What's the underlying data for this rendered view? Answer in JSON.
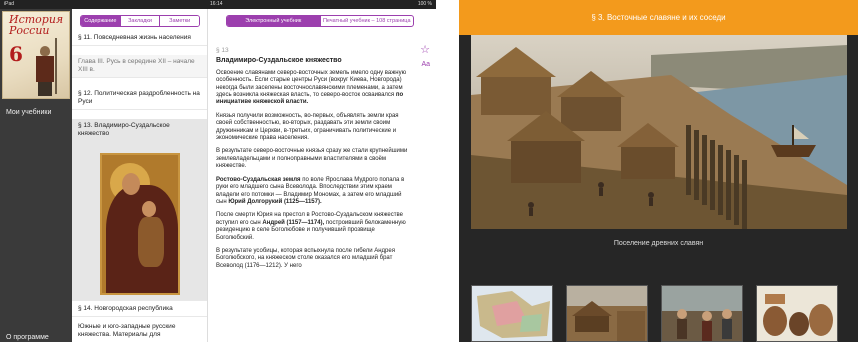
{
  "left_ipad": {
    "status": {
      "device": "iPad",
      "time": "16:14",
      "battery": "100 %"
    },
    "shelf": {
      "cover_title": "История России",
      "cover_grade": "6",
      "my_books": "Мои учебники",
      "about": "О программе"
    },
    "toc": {
      "tabs": [
        "Содержание",
        "Закладки",
        "Заметки"
      ],
      "items": [
        "§ 11. Повседневная жизнь населения",
        "Глава III. Русь в середине XII – начале XIII в.",
        "§ 12. Политическая раздробленность на Руси",
        "§ 13. Владимиро-Суздальское княжество",
        "§ 14. Новгородская республика",
        "Южные и юго-западные русские княжества. Материалы для"
      ]
    },
    "reader": {
      "tabs": [
        "Электронный учебник",
        "Печатный учебник – 108 страница"
      ],
      "section": "§ 13",
      "heading": "Владимиро-Суздальское княжество",
      "paragraphs": [
        "Освоение славянами северо-восточных земель имело одну важную особенность. Если старые центры Руси (вокруг Киева, Новгорода) некогда были заселены восточнославянскими племенами, а затем здесь возникла княжеская власть, то северо-восток осваивался",
        "Князья получили возможность, во-первых, объявлять земли края своей собственностью, во-вторых, раздавать эти земли своим дружинникам и Церкви, в-третьих, ограничивать политические и экономические права населения.",
        "В результате северо-восточные князья сразу же стали крупнейшими землевладельцами и полноправными властителями в своём княжестве.",
        "по воле Ярослава Мудрого попала в руки его младшего сына Всеволода. Впоследствии этим краем владели его потомки — Владимир Мономах, а затем его младший сын",
        "После смерти Юрия на престол в Ростово-Суздальском княжестве вступил его сын",
        "построивший белокаменную резиденцию в селе Боголюбове и получивший прозвище Боголюбский.",
        "В результате усобицы, которая вспыхнула после гибели Андрея Боголюбского, на княжеском столе оказался его"
      ],
      "p1_bold": "по инициативе княжеской власти.",
      "p4_bold": "Ростово-Суздальская земля",
      "p4_bold2": "Юрий Долгорукий (1125—1157).",
      "p5_bold": "Андрей (1157—1174),",
      "p7_tail": "младший брат Всеволод (1176—1212). У него"
    }
  },
  "right_ipad": {
    "header_title": "§ 3. Восточные славяне и их соседи",
    "caption": "Поселение древних славян",
    "thumbnails": [
      "map-thumbnail",
      "settlement-thumbnail",
      "people-thumbnail",
      "pottery-thumbnail"
    ]
  }
}
